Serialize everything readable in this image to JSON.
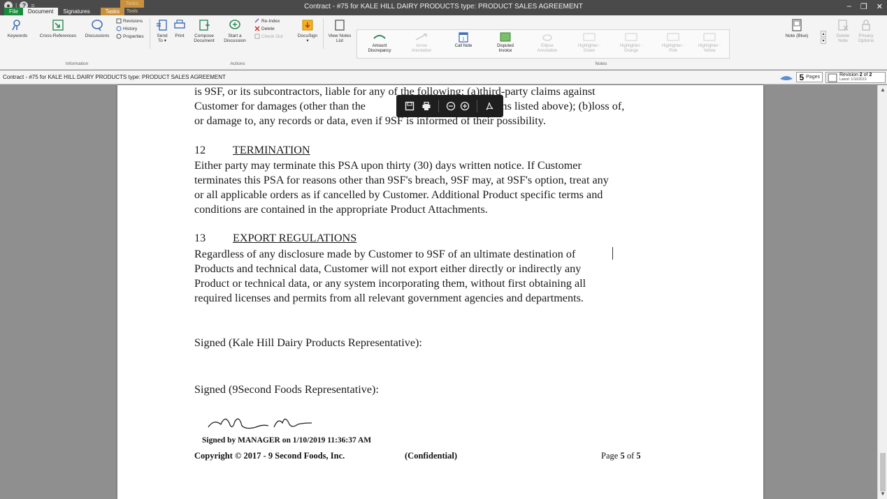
{
  "window": {
    "title": "Contract - #75 for KALE HILL DAIRY PRODUCTS type: PRODUCT SALES AGREEMENT",
    "context_tab": "Tasks Tools",
    "controls": {
      "minimize": "–",
      "restore": "❐",
      "close": "✕"
    }
  },
  "quick_access": {
    "help": "?"
  },
  "tabs": [
    "File",
    "Document",
    "Signatures",
    "Tasks"
  ],
  "ribbon": {
    "information": {
      "label": "Information",
      "keywords": "Keywords",
      "cross_references": "Cross-References",
      "discussions": "Discussions",
      "revisions": "Revisions",
      "history": "History",
      "properties": "Properties"
    },
    "actions": {
      "label": "Actions",
      "send_to_1": "Send",
      "send_to_2": "To ▾",
      "print": "Print",
      "compose_1": "Compose",
      "compose_2": "Document",
      "start_1": "Start a",
      "start_2": "Discussion",
      "reindex": "Re-Index",
      "delete": "Delete",
      "checkout": "Check Out",
      "docusign": "DocuSign",
      "docusign_arrow": "▾",
      "viewnotes_1": "View Notes",
      "viewnotes_2": "List"
    },
    "notes": {
      "label": "Notes",
      "items": [
        {
          "l1": "Amount",
          "l2": "Discrepancy"
        },
        {
          "l1": "Arrow",
          "l2": "Annotation"
        },
        {
          "l1": "Call Note",
          "l2": ""
        },
        {
          "l1": "Disputed",
          "l2": "Invoice"
        },
        {
          "l1": "Ellipse",
          "l2": "Annotation"
        },
        {
          "l1": "Highlighter -",
          "l2": "Green"
        },
        {
          "l1": "Highlighter -",
          "l2": "Orange"
        },
        {
          "l1": "Highlighter -",
          "l2": "Pink"
        },
        {
          "l1": "Highlighter -",
          "l2": "Yellow"
        }
      ],
      "note_blue": "Note (Blue)",
      "delete_note_1": "Delete",
      "delete_note_2": "Note",
      "privacy_1": "Privacy",
      "privacy_2": "Options"
    }
  },
  "breadcrumb": "Contract - #75 for KALE HILL DAIRY PRODUCTS type: PRODUCT SALES AGREEMENT",
  "pages": {
    "count": "5",
    "label": "Pages"
  },
  "revision": {
    "prefix": "Revision ",
    "current": "2",
    "of_text": " of ",
    "total": "2",
    "latest": "Latest: 1/10/2019"
  },
  "document": {
    "lines_top": [
      "is 9SF, or its subcontractors, liable for any of the following: (a)third-party claims against",
      "Customer for damages (other than the",
      "wo items listed above); (b)loss of,",
      "or damage to, any records or data, even if 9SF is informed of their possibility."
    ],
    "section12": {
      "number": "12",
      "title": "TERMINATION",
      "lines": [
        "Either party may terminate this PSA upon thirty (30) days written notice. If Customer",
        "terminates this PSA for reasons other than 9SF's breach, 9SF may, at 9SF's option, treat any",
        "or all applicable orders as if cancelled by Customer. Additional Product specific terms and",
        "conditions are contained in the appropriate Product Attachments."
      ]
    },
    "section13": {
      "number": "13",
      "title": "EXPORT REGULATIONS",
      "lines": [
        "Regardless of any disclosure made by Customer to 9SF of an ultimate destination of",
        "Products and technical data, Customer will not export either directly or indirectly any",
        "Product or technical data, or any system incorporating them, without first obtaining all",
        "required licenses and permits from all relevant government agencies and departments."
      ]
    },
    "signed_kale": "Signed (Kale Hill Dairy Products Representative):",
    "signed_9second": "Signed (9Second Foods Representative):",
    "signed_by": "Signed by MANAGER on 1/10/2019 11:36:37 AM",
    "copyright": "Copyright © 2017  - 9 Second Foods, Inc.",
    "confidential": "(Confidential)",
    "page_prefix": "Page ",
    "page_current": "5",
    "page_of": " of ",
    "page_total": "5"
  },
  "floating_toolbar": {
    "icons": [
      "save-icon",
      "print-icon",
      "zoom-out-icon",
      "zoom-in-icon",
      "pdf-icon"
    ]
  },
  "colors": {
    "file_tab": "#1a8b3d",
    "context_tab": "#c7913f",
    "titlebar": "#4a4a4a",
    "ribbon": "#f4f4f4",
    "canvas": "#8f8f8f"
  }
}
